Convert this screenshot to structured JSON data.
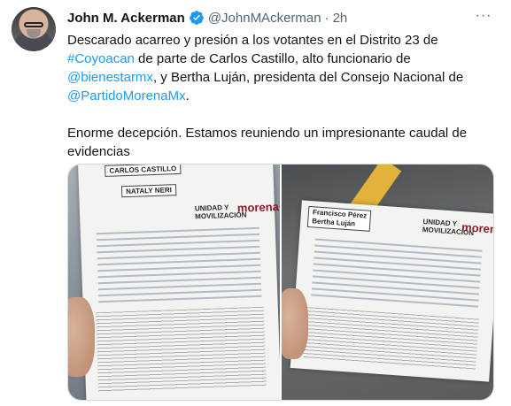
{
  "tweet": {
    "author_name": "John M. Ackerman",
    "handle": "@JohnMAckerman",
    "separator": "·",
    "time": "2h",
    "more_label": "···",
    "text_parts": {
      "p1_a": "Descarado acarreo y presión a los votantes en el Distrito 23 de",
      "p1_link1": "#Coyoacan",
      "p1_b": " de parte de Carlos Castillo, alto funcionario de",
      "p1_link2": "@bienestarmx",
      "p1_c": ", y Bertha Luján, presidenta del Consejo Nacional de",
      "p1_link3": "@PartidoMorenaMx",
      "p1_d": ".",
      "p2": "Enorme decepción. Estamos reuniendo un impresionante caudal de evidencias"
    }
  },
  "media": {
    "left_photo": {
      "top_label_1": "CARLOS CASTILLO",
      "top_label_2": "NATALY NERI",
      "logo_unidad": "UNIDAD Y MOVILIZACIÓN",
      "logo_morena": "morena"
    },
    "right_photo": {
      "name_label_1": "Francisco Pérez",
      "name_label_2": "Bertha Luján",
      "logo_unidad": "UNIDAD Y MOVILIZACIÓN",
      "logo_morena": "morena"
    }
  },
  "colors": {
    "link": "#1d9bf0",
    "verified": "#1d9bf0",
    "text": "#0f1419",
    "muted": "#536471"
  },
  "icons": {
    "verified": "verified-badge-icon",
    "more": "more-options-icon"
  }
}
